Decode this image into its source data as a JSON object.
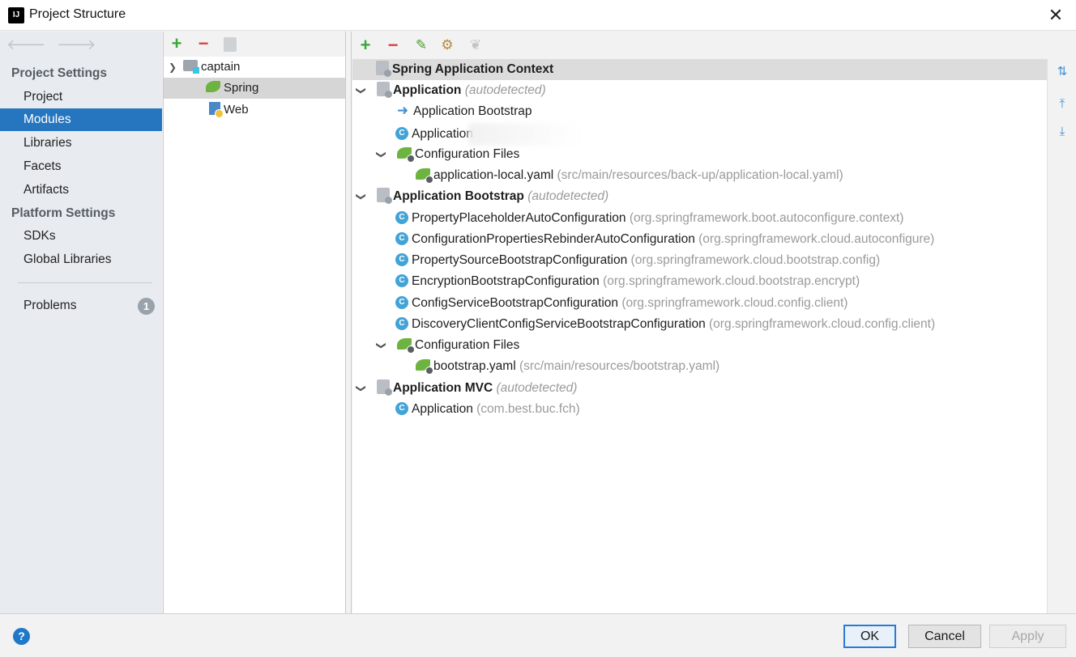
{
  "window": {
    "title": "Project Structure",
    "close_glyph": "✕"
  },
  "sidebar": {
    "nav_back": "🡐",
    "nav_forward": "🡒",
    "section_project": "Project Settings",
    "project_items": [
      "Project",
      "Modules",
      "Libraries",
      "Facets",
      "Artifacts"
    ],
    "section_platform": "Platform Settings",
    "platform_items": [
      "SDKs",
      "Global Libraries"
    ],
    "problems_label": "Problems",
    "problems_count": "1",
    "selected": "Modules"
  },
  "modules": {
    "add": "+",
    "remove": "−",
    "root": "captain",
    "children": [
      "Spring",
      "Web"
    ],
    "selected": "Spring"
  },
  "detail": {
    "toolbar": {
      "add": "+",
      "remove": "−"
    },
    "context_header": "Spring Application Context",
    "application": {
      "label": "Application",
      "tag": "(autodetected)",
      "bootstrap_ref": "Application Bootstrap",
      "app_class": "Application",
      "config_files_label": "Configuration Files",
      "config_file_name": "application-local.yaml",
      "config_file_path": "(src/main/resources/back-up/application-local.yaml)"
    },
    "bootstrap": {
      "label": "Application Bootstrap",
      "tag": "(autodetected)",
      "classes": [
        {
          "name": "PropertyPlaceholderAutoConfiguration",
          "pkg": "(org.springframework.boot.autoconfigure.context)"
        },
        {
          "name": "ConfigurationPropertiesRebinderAutoConfiguration",
          "pkg": "(org.springframework.cloud.autoconfigure)"
        },
        {
          "name": "PropertySourceBootstrapConfiguration",
          "pkg": "(org.springframework.cloud.bootstrap.config)"
        },
        {
          "name": "EncryptionBootstrapConfiguration",
          "pkg": "(org.springframework.cloud.bootstrap.encrypt)"
        },
        {
          "name": "ConfigServiceBootstrapConfiguration",
          "pkg": "(org.springframework.cloud.config.client)"
        },
        {
          "name": "DiscoveryClientConfigServiceBootstrapConfiguration",
          "pkg": "(org.springframework.cloud.config.client)"
        }
      ],
      "config_files_label": "Configuration Files",
      "config_file_name": "bootstrap.yaml",
      "config_file_path": "(src/main/resources/bootstrap.yaml)"
    },
    "mvc": {
      "label": "Application MVC",
      "tag": "(autodetected)",
      "app_class": "Application",
      "app_pkg": "(com.best.buc.fch)"
    }
  },
  "footer": {
    "help": "?",
    "ok": "OK",
    "cancel": "Cancel",
    "apply": "Apply"
  },
  "colors": {
    "selection": "#2675bf",
    "accent": "#2b7bd6",
    "spring_green": "#6db33f",
    "hint_gray": "#9a9a9a"
  }
}
